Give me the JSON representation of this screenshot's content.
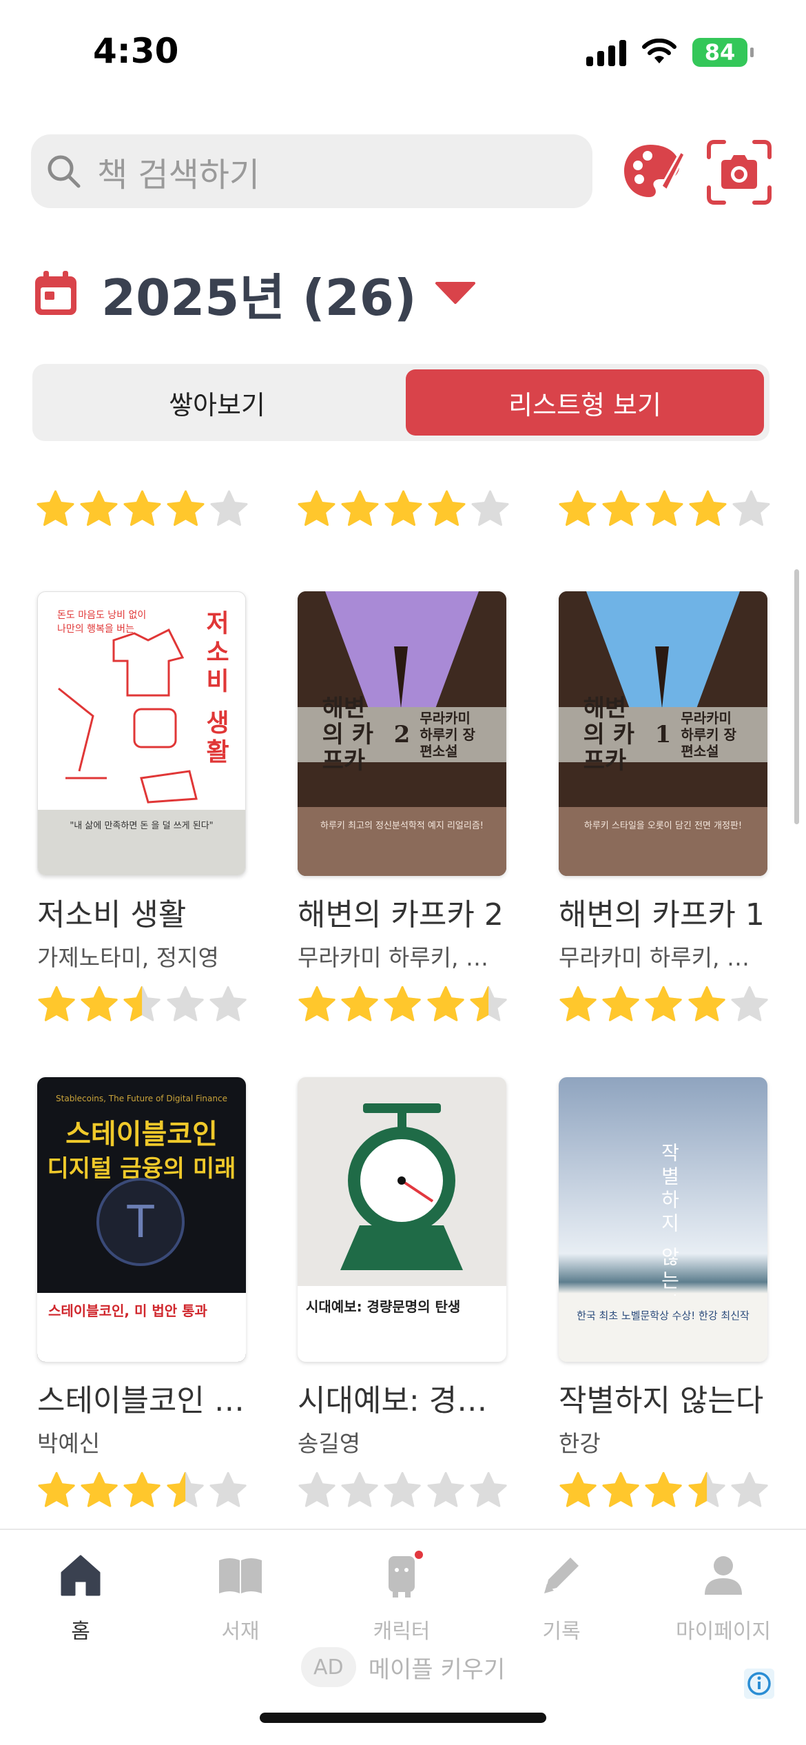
{
  "status": {
    "time": "4:30",
    "battery": "84"
  },
  "search": {
    "placeholder": "책 검색하기"
  },
  "year_header": {
    "label": "2025년 (26)"
  },
  "view_toggle": {
    "stack_label": "쌓아보기",
    "list_label": "리스트형 보기",
    "active": "list"
  },
  "top_row_ratings": [
    4,
    4,
    4
  ],
  "books": [
    {
      "title": "저소비 생활",
      "author": "가제노타미, 정지영",
      "rating": 2.5
    },
    {
      "title": "해변의 카프카 2",
      "author": "무라카미 하루키, 김춘미",
      "rating": 4.5
    },
    {
      "title": "해변의 카프카 1",
      "author": "무라카미 하루키, 김춘미",
      "rating": 4
    },
    {
      "title": "스테이블코인 디지털 금융의 미래",
      "author": "박예신",
      "rating": 3.5
    },
    {
      "title": "시대예보: 경량문명의 탄생",
      "author": "송길영",
      "rating": 0
    },
    {
      "title": "작별하지 않는다",
      "author": "한강",
      "rating": 3.5
    }
  ],
  "cover_text": {
    "c1_title": "저소비 생활",
    "c1_top": "돈도 마음도 낭비 없이 나만의 행복을 버는",
    "c1_band": "\"내 삶에 만족하면 돈 을 덜 쓰게 된다\"",
    "c2_title": "해변의 카프카",
    "c2_num": "2",
    "c2_author": "무라카미 하루키 장편소설",
    "c2_band": "하루키 최고의 정신분석학적 예지 리얼리즘!",
    "c3_title": "해변의 카프카",
    "c3_num": "1",
    "c3_author": "무라카미 하루키 장편소설",
    "c3_band": "하루키 스타일을 오롯이 담긴 전면 개정판!",
    "c4_sub": "Stablecoins, The Future of Digital Finance",
    "c4_head1": "스테이블코인",
    "c4_head2": "디지털 금융의 미래",
    "c4_red": "스테이블코인, 미 법안 통과",
    "c5_band": "시대예보: 경량문명의 탄생",
    "c6_title": "작별하지 않는다",
    "c6_band": "한국 최초 노벨문학상 수상! 한강 최신작"
  },
  "nav": [
    {
      "label": "홈",
      "icon": "home-icon",
      "active": true
    },
    {
      "label": "서재",
      "icon": "book-icon",
      "active": false
    },
    {
      "label": "캐릭터",
      "icon": "character-icon",
      "active": false
    },
    {
      "label": "기록",
      "icon": "pencil-icon",
      "active": false
    },
    {
      "label": "마이페이지",
      "icon": "person-icon",
      "active": false
    }
  ],
  "ad": {
    "badge": "AD",
    "text": "메이플 키우기"
  },
  "colors": {
    "accent": "#d9434a",
    "star": "#ffc72c",
    "star_empty": "#dcdcdc"
  }
}
